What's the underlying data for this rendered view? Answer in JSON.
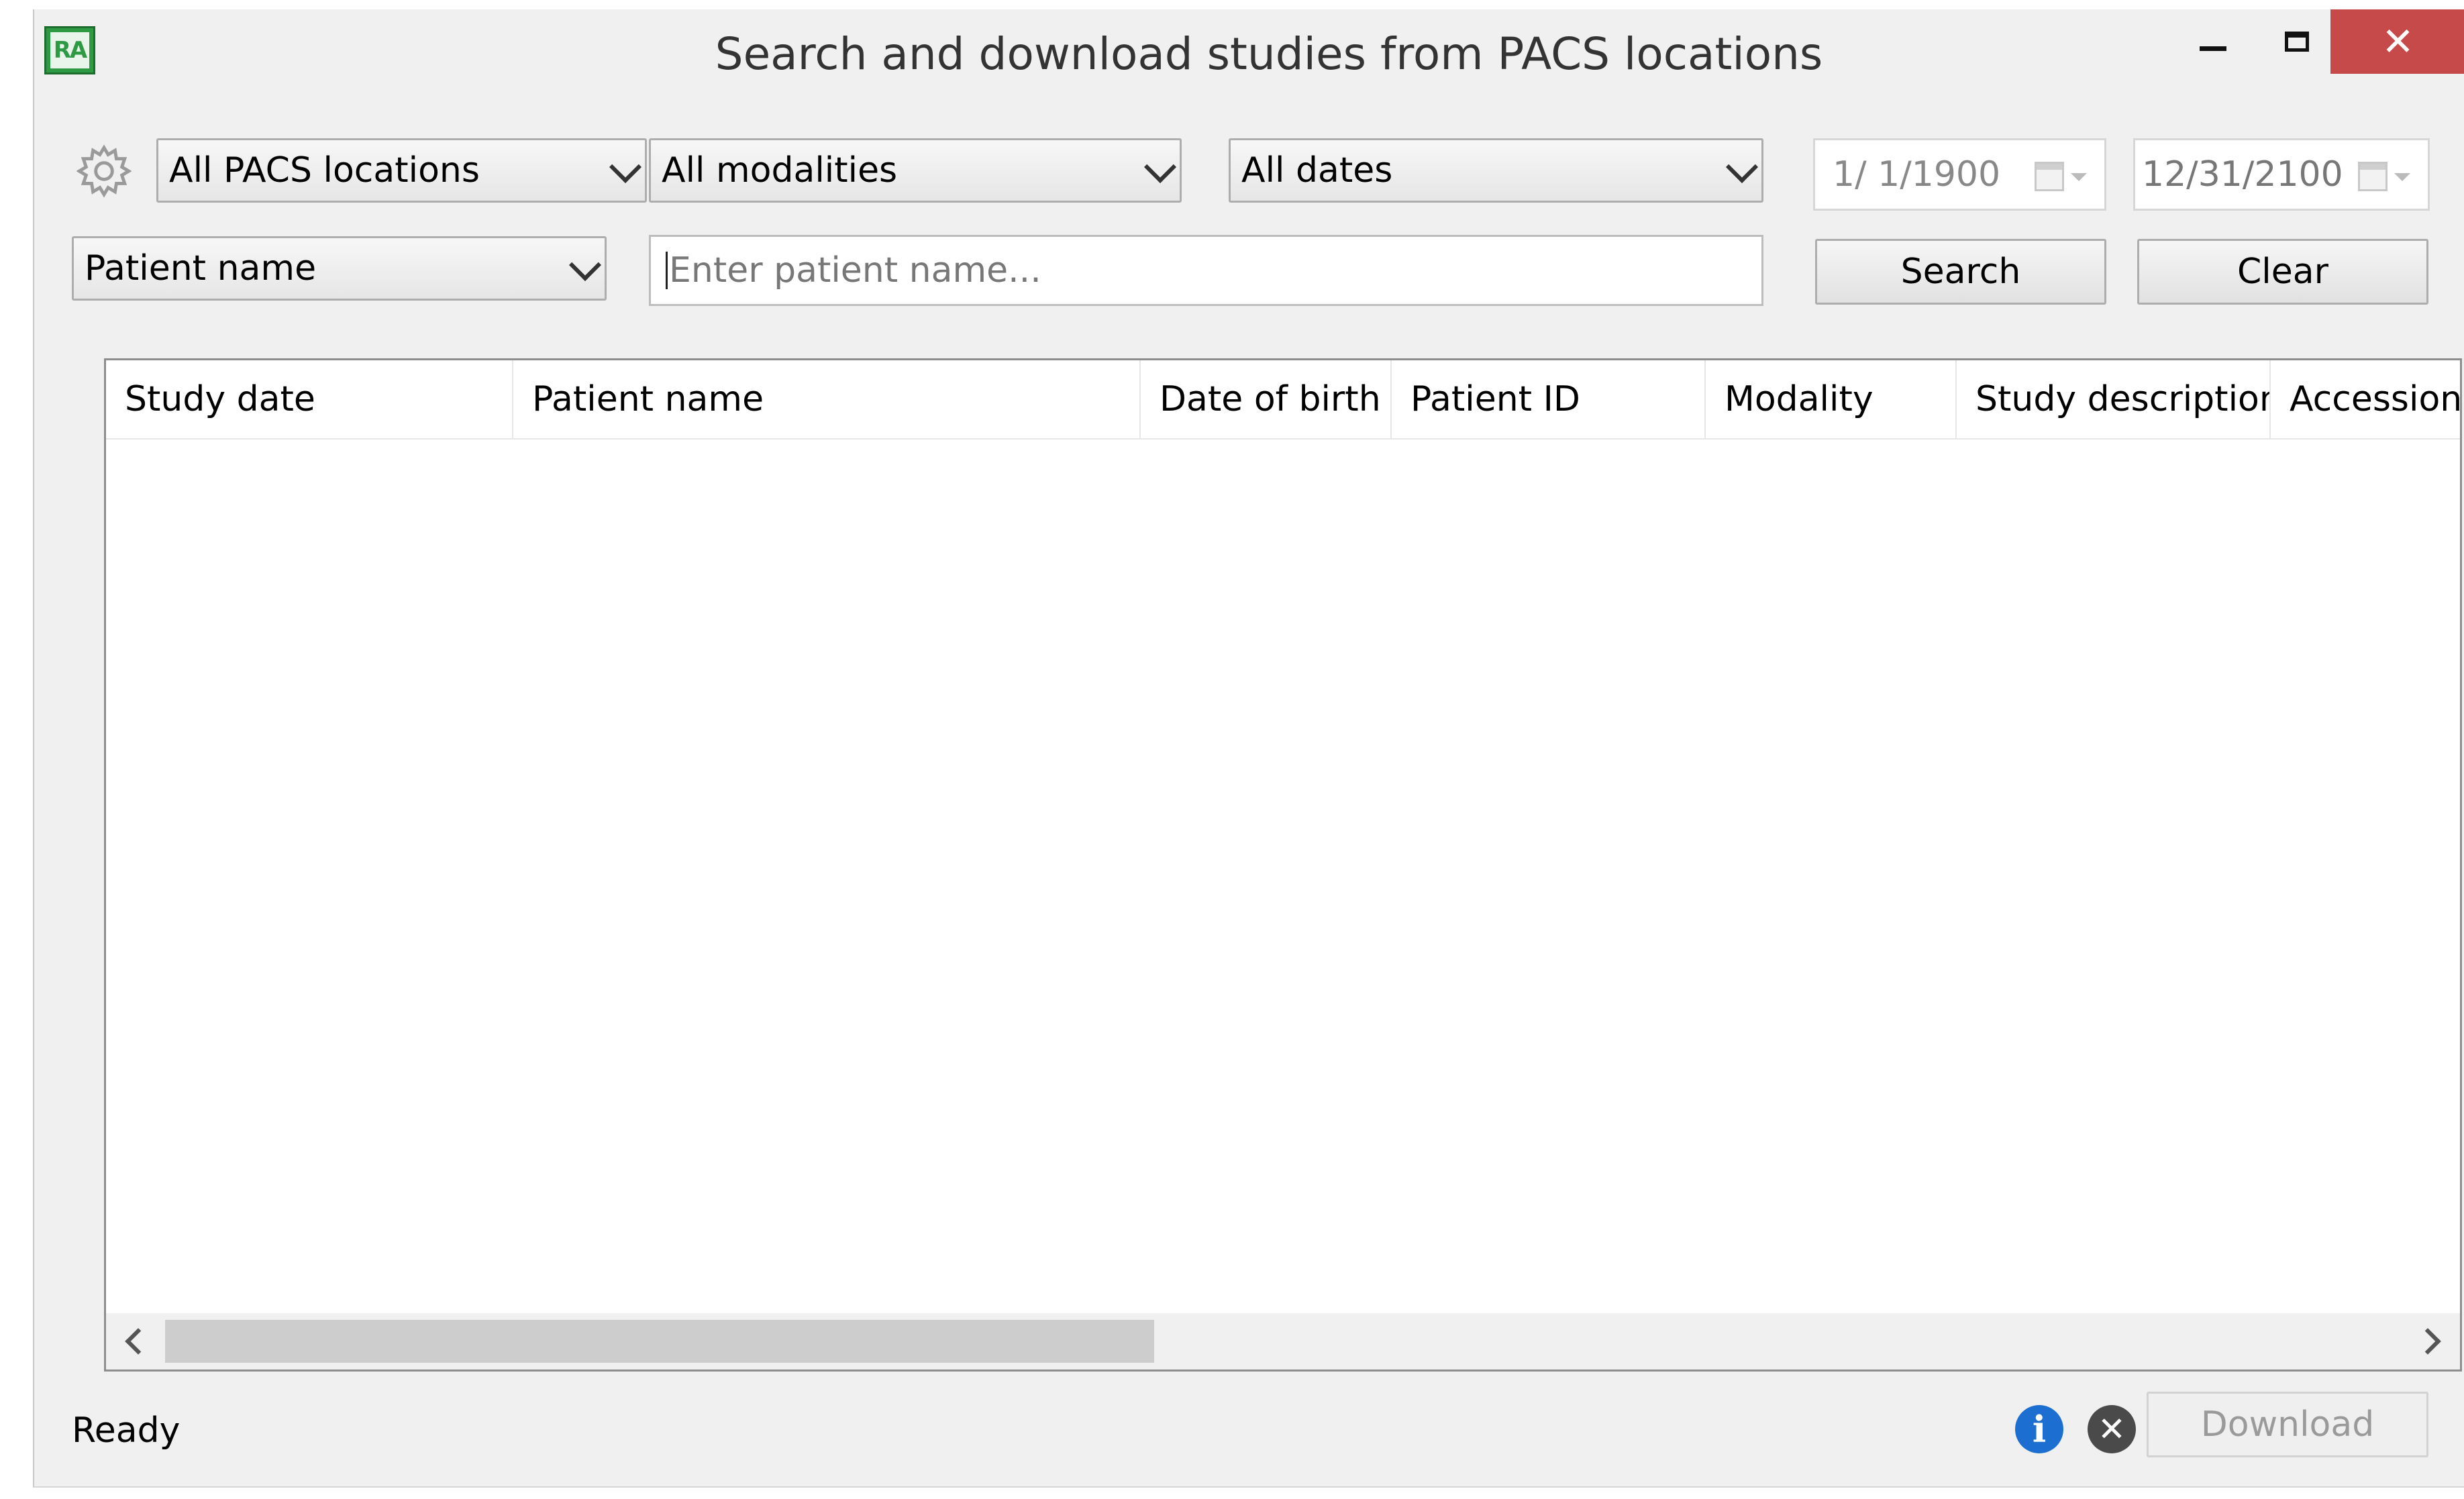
{
  "window": {
    "title": "Search and download studies from PACS locations",
    "app_icon_text": "RA",
    "close_glyph": "✕"
  },
  "filters": {
    "location": "All PACS locations",
    "modality": "All modalities",
    "date_range": "All dates",
    "date_from": "1/ 1/1900",
    "date_to": "12/31/2100",
    "search_field": "Patient name",
    "search_placeholder": "Enter patient name..."
  },
  "buttons": {
    "search": "Search",
    "clear": "Clear",
    "download": "Download"
  },
  "table": {
    "columns": [
      "Study date",
      "Patient name",
      "Date of birth",
      "Patient ID",
      "Modality",
      "Study description",
      "Accession r"
    ],
    "rows": []
  },
  "status": {
    "text": "Ready",
    "info_glyph": "i",
    "cancel_glyph": "✕"
  },
  "colors": {
    "close_button": "#c74a4a",
    "info_icon": "#1c6fd0",
    "app_icon": "#2e9a44"
  }
}
